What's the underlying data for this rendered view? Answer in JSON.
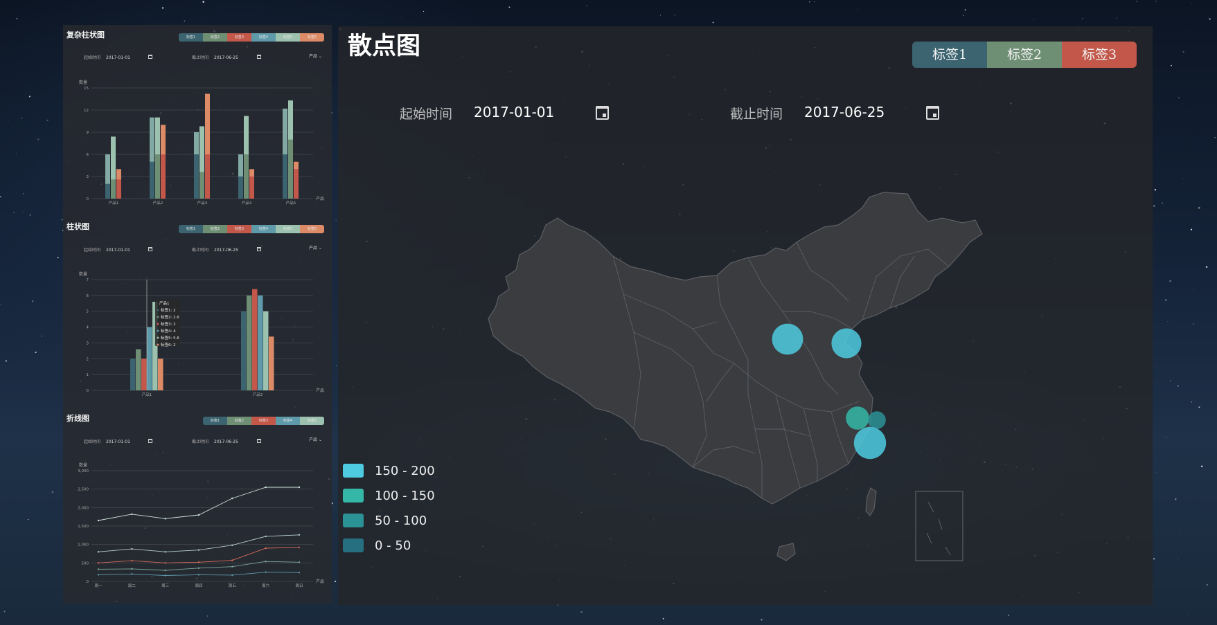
{
  "colors": {
    "tag1": "#3b6470",
    "tag2": "#6f8f75",
    "tag3": "#c2574a",
    "tag4": "#5f9aaa",
    "tag5": "#9cc1ae",
    "tag6": "#dd8a66"
  },
  "main": {
    "title": "散点图",
    "tabs": [
      "标签1",
      "标签2",
      "标签3"
    ],
    "start_label": "起始时间",
    "start_value": "2017-01-01",
    "end_label": "截止时间",
    "end_value": "2017-06-25",
    "map_legend": [
      {
        "label": "150 - 200",
        "color": "#4ecbe0"
      },
      {
        "label": "100 - 150",
        "color": "#35b7a8"
      },
      {
        "label": "50 - 100",
        "color": "#2b9296"
      },
      {
        "label": "0 - 50",
        "color": "#266f80"
      }
    ],
    "scatter_points": [
      {
        "value": 180,
        "color": "#4ecbe0"
      },
      {
        "value": 170,
        "color": "#4ecbe0"
      },
      {
        "value": 110,
        "color": "#35b7a8"
      },
      {
        "value": 60,
        "color": "#2b9296"
      },
      {
        "value": 190,
        "color": "#4ecbe0"
      }
    ]
  },
  "charts": [
    {
      "title": "复杂柱状图",
      "legend": [
        "标签1",
        "标签2",
        "标签3",
        "标签4",
        "标签5",
        "标签6"
      ],
      "start_label": "起始时间",
      "start_value": "2017-01-01",
      "end_label": "截止时间",
      "end_value": "2017-06-25",
      "select": "产品"
    },
    {
      "title": "柱状图",
      "legend": [
        "标签1",
        "标签2",
        "标签3",
        "标签4",
        "标签5",
        "标签6"
      ],
      "start_label": "起始时间",
      "start_value": "2017-01-01",
      "end_label": "截止时间",
      "end_value": "2017-06-25",
      "select": "产品"
    },
    {
      "title": "折线图",
      "legend": [
        "标签1",
        "标签2",
        "标签3",
        "标签4",
        "标签5"
      ],
      "start_label": "起始时间",
      "start_value": "2017-01-01",
      "end_label": "截止时间",
      "end_value": "2017-06-25",
      "select": "产品"
    }
  ],
  "chart_data": [
    {
      "type": "bar",
      "ylabel": "数量",
      "xlabel": "产品",
      "ylim": [
        0,
        15
      ],
      "yticks": [
        "0",
        "3",
        "6",
        "9",
        "12",
        "15"
      ],
      "categories": [
        "产品1",
        "产品2",
        "产品3",
        "产品4",
        "产品5"
      ],
      "series": [
        {
          "name": "标签1",
          "values": [
            6,
            11,
            9,
            6,
            12.2
          ],
          "inner": [
            2,
            5,
            6,
            3,
            6
          ]
        },
        {
          "name": "标签2",
          "values": [
            8.4,
            11,
            9.8,
            11.2,
            13.3
          ],
          "inner": [
            2.6,
            6,
            3.6,
            6,
            8
          ]
        },
        {
          "name": "标签3",
          "values": [
            4,
            10,
            14.2,
            4,
            5
          ],
          "inner": [
            2.6,
            6,
            6,
            3,
            4
          ]
        }
      ]
    },
    {
      "type": "bar",
      "ylabel": "数量",
      "xlabel": "产品",
      "ylim": [
        0,
        7
      ],
      "yticks": [
        "0",
        "1",
        "2",
        "3",
        "4",
        "5",
        "6",
        "7"
      ],
      "categories": [
        "产品1",
        "产品2"
      ],
      "series": [
        {
          "name": "标签1",
          "values": [
            2,
            5
          ]
        },
        {
          "name": "标签2",
          "values": [
            2.6,
            6
          ]
        },
        {
          "name": "标签3",
          "values": [
            2,
            6.4
          ]
        },
        {
          "name": "标签4",
          "values": [
            4,
            6
          ]
        },
        {
          "name": "标签5",
          "values": [
            5.6,
            5
          ]
        },
        {
          "name": "标签6",
          "values": [
            2,
            3.4
          ]
        }
      ],
      "tooltip": {
        "title": "产品1",
        "lines": [
          "标签1: 2",
          "标签2: 2.6",
          "标签3: 2",
          "标签4: 4",
          "标签5: 5.6",
          "标签6: 2"
        ]
      }
    },
    {
      "type": "line",
      "ylabel": "数量",
      "xlabel": "产品",
      "ylim": [
        0,
        3000
      ],
      "yticks": [
        "0",
        "500",
        "1,000",
        "1,500",
        "2,000",
        "2,500",
        "3,000"
      ],
      "categories": [
        "周一",
        "周二",
        "周三",
        "周四",
        "周五",
        "周六",
        "周日"
      ],
      "series": [
        {
          "name": "标签1",
          "values": [
            1650,
            1820,
            1700,
            1800,
            2250,
            2550,
            2550
          ]
        },
        {
          "name": "标签2",
          "values": [
            800,
            880,
            800,
            850,
            980,
            1220,
            1260
          ]
        },
        {
          "name": "标签3",
          "values": [
            500,
            560,
            500,
            520,
            570,
            900,
            920
          ]
        },
        {
          "name": "标签4",
          "values": [
            330,
            340,
            300,
            360,
            400,
            540,
            520
          ]
        },
        {
          "name": "标签5",
          "values": [
            180,
            200,
            160,
            180,
            170,
            250,
            240
          ]
        }
      ]
    }
  ]
}
